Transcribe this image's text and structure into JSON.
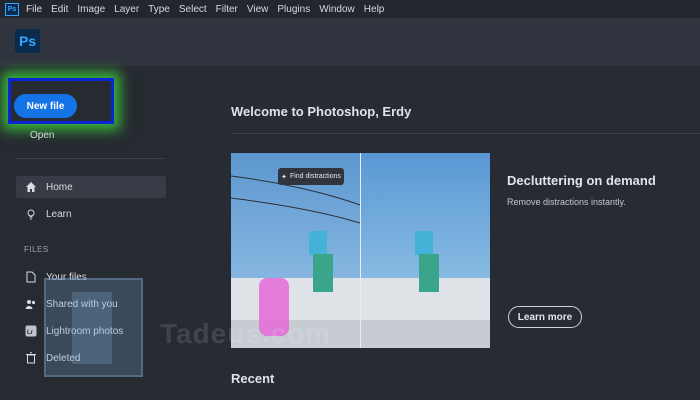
{
  "app": {
    "icon_text": "Ps",
    "menu": [
      "File",
      "Edit",
      "Image",
      "Layer",
      "Type",
      "Select",
      "Filter",
      "View",
      "Plugins",
      "Window",
      "Help"
    ]
  },
  "sidebar": {
    "new_file": "New file",
    "open": "Open",
    "items": [
      {
        "label": "Home",
        "icon": "home-icon"
      },
      {
        "label": "Learn",
        "icon": "lightbulb-icon"
      }
    ],
    "files_section": "FILES",
    "files": [
      {
        "label": "Your files",
        "icon": "file-icon"
      },
      {
        "label": "Shared with you",
        "icon": "shared-user-icon"
      },
      {
        "label": "Lightroom photos",
        "icon": "lightroom-icon"
      },
      {
        "label": "Deleted",
        "icon": "trash-icon"
      }
    ]
  },
  "main": {
    "welcome": "Welcome to Photoshop, Erdy",
    "feature": {
      "tooltip": "Find distractions",
      "title": "Decluttering on demand",
      "description": "Remove distractions instantly.",
      "button": "Learn more"
    },
    "recent": "Recent"
  },
  "watermark": {
    "text": "Tadeus.com"
  },
  "colors": {
    "accent": "#1473e6",
    "highlight_border": "#0a24d8",
    "highlight_glow": "#3cdc3c"
  }
}
